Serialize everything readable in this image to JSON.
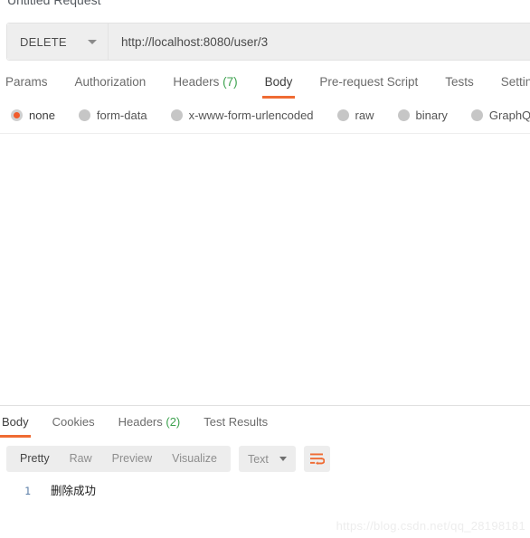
{
  "request": {
    "title": "Untitled Request",
    "method": "DELETE",
    "url": "http://localhost:8080/user/3",
    "method_caret_icon": "chevron-down-icon",
    "tabs": [
      {
        "label": "Params",
        "count": "",
        "active": false
      },
      {
        "label": "Authorization",
        "count": "",
        "active": false
      },
      {
        "label": "Headers",
        "count": "(7)",
        "active": false
      },
      {
        "label": "Body",
        "count": "",
        "active": true
      },
      {
        "label": "Pre-request Script",
        "count": "",
        "active": false
      },
      {
        "label": "Tests",
        "count": "",
        "active": false
      },
      {
        "label": "Settings",
        "count": "",
        "active": false
      }
    ],
    "body_types": [
      {
        "label": "none",
        "selected": true
      },
      {
        "label": "form-data",
        "selected": false
      },
      {
        "label": "x-www-form-urlencoded",
        "selected": false
      },
      {
        "label": "raw",
        "selected": false
      },
      {
        "label": "binary",
        "selected": false
      },
      {
        "label": "GraphQL",
        "selected": false
      }
    ]
  },
  "response": {
    "tabs": [
      {
        "label": "Body",
        "count": "",
        "active": true
      },
      {
        "label": "Cookies",
        "count": "",
        "active": false
      },
      {
        "label": "Headers",
        "count": "(2)",
        "active": false
      },
      {
        "label": "Test Results",
        "count": "",
        "active": false
      }
    ],
    "view_modes": [
      {
        "label": "Pretty",
        "active": true
      },
      {
        "label": "Raw",
        "active": false
      },
      {
        "label": "Preview",
        "active": false
      },
      {
        "label": "Visualize",
        "active": false
      }
    ],
    "format": {
      "label": "Text",
      "caret_icon": "chevron-down-icon"
    },
    "wrap_icon": "word-wrap-icon",
    "body_lines": [
      {
        "number": "1",
        "text": "删除成功"
      }
    ]
  },
  "watermark": "https://blog.csdn.net/qq_28198181",
  "colors": {
    "accent": "#ef6b33",
    "radio_selected": "#f15b2b",
    "count_green": "#3ca14e",
    "line_number": "#5b7ea8"
  }
}
